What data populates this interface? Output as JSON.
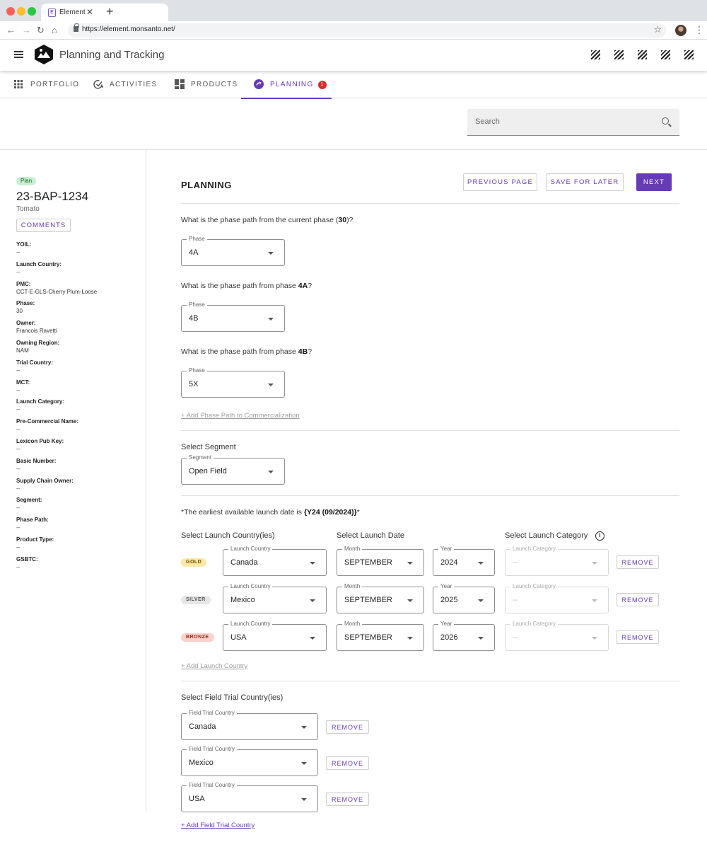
{
  "browser": {
    "tab_title": "Element",
    "tab_close": "✕",
    "new_tab": "+",
    "url": "https://element.monsanto.net/",
    "nav_icons": [
      "back-arrow-icon",
      "forward-arrow-icon",
      "reload-icon",
      "home-icon"
    ]
  },
  "app": {
    "title": "Planning and Tracking"
  },
  "tabs": [
    {
      "label": "PORTFOLIO",
      "icon": "grid-icon"
    },
    {
      "label": "ACTIVITIES",
      "icon": "check-circle-icon"
    },
    {
      "label": "PRODUCTS",
      "icon": "dashboard-icon"
    },
    {
      "label": "PLANNING",
      "icon": "planning-icon",
      "badge": "1",
      "active": true
    }
  ],
  "search": {
    "placeholder": "Search"
  },
  "sidebar": {
    "status": "Plan",
    "id": "23-BAP-1234",
    "crop": "Tomato",
    "comments_label": "COMMENTS",
    "fields": [
      {
        "label": "YOIL:",
        "value": "--"
      },
      {
        "label": "Launch Country:",
        "value": "--"
      },
      {
        "label": "PMC:",
        "value": "CCT-E-GLS-Cherry Plum-Loose"
      },
      {
        "label": "Phase:",
        "value": "30"
      },
      {
        "label": "Owner:",
        "value": "Francois Ravetti"
      },
      {
        "label": "Owning Region:",
        "value": "NAM"
      },
      {
        "label": "Trial Country:",
        "value": "--"
      },
      {
        "label": "MCT:",
        "value": "--"
      },
      {
        "label": "Launch Category:",
        "value": "--"
      },
      {
        "label": "Pre-Commercial Name:",
        "value": "--"
      },
      {
        "label": "Lexicon Pub Key:",
        "value": "--"
      },
      {
        "label": "Basic Number:",
        "value": "--"
      },
      {
        "label": "Supply Chain Owner:",
        "value": "--"
      },
      {
        "label": "Segment:",
        "value": "--"
      },
      {
        "label": "Phase Path:",
        "value": "--"
      },
      {
        "label": "Product Type:",
        "value": "--"
      },
      {
        "label": "GSBTC:",
        "value": "--"
      }
    ]
  },
  "main": {
    "heading": "PLANNING",
    "prev_label": "PREVIOUS PAGE",
    "save_label": "SAVE FOR LATER",
    "next_label": "NEXT",
    "phase_questions": [
      {
        "pre": "What is the phase path from the current phase (",
        "bold": "30",
        "post": ")?",
        "select_label": "Phase",
        "value": "4A"
      },
      {
        "pre": "What is the phase path from phase ",
        "bold": "4A",
        "post": "?",
        "select_label": "Phase",
        "value": "4B"
      },
      {
        "pre": "What is the phase path from phase ",
        "bold": "4B",
        "post": "?",
        "select_label": "Phase",
        "value": "5X"
      }
    ],
    "add_phase_path": "+ Add Phase Path to Commercialization",
    "segment_heading": "Select Segment",
    "segment": {
      "label": "Segment",
      "value": "Open Field"
    },
    "launch_note_pre": "*The earliest available launch date is ",
    "launch_note_bold": "{Y24 (09/2024)}",
    "launch_note_post": "*",
    "launch_country_heading": "Select Launch Country(ies)",
    "launch_date_heading": "Select Launch Date",
    "launch_category_heading": "Select Launch Category",
    "info_icon_glyph": "i",
    "launch_rows": [
      {
        "tier": "GOLD",
        "tier_bg": "#fde8a6",
        "tier_fg": "#6b4e00",
        "country_label": "Launch Country",
        "country": "Canada",
        "month_label": "Month",
        "month": "SEPTEMBER",
        "year_label": "Year",
        "year": "2024",
        "category_label": "Launch Category",
        "category": "--",
        "remove": "REMOVE"
      },
      {
        "tier": "SILVER",
        "tier_bg": "#e6e6e6",
        "tier_fg": "#555555",
        "country_label": "Launch Country",
        "country": "Mexico",
        "month_label": "Month",
        "month": "SEPTEMBER",
        "year_label": "Year",
        "year": "2025",
        "category_label": "Launch Category",
        "category": "--",
        "remove": "REMOVE"
      },
      {
        "tier": "BRONZE",
        "tier_bg": "#f8d2cd",
        "tier_fg": "#a1261a",
        "country_label": "Launch Country",
        "country": "USA",
        "month_label": "Month",
        "month": "SEPTEMBER",
        "year_label": "Year",
        "year": "2026",
        "category_label": "Launch Category",
        "category": "--",
        "remove": "REMOVE"
      }
    ],
    "add_launch_country": "+ Add Launch Country",
    "field_trial_heading": "Select Field Trial Country(ies)",
    "field_trials": [
      {
        "label": "Field Trial Country",
        "value": "Canada",
        "remove": "REMOVE"
      },
      {
        "label": "Field Trial Country",
        "value": "Mexico",
        "remove": "REMOVE"
      },
      {
        "label": "Field Trial Country",
        "value": "USA",
        "remove": "REMOVE"
      }
    ],
    "add_field_trial": "+ Add Field Trial Country"
  },
  "colors": {
    "accent": "#673ab7",
    "badge": "#d32f2f",
    "plan_chip": "#c8f0d2"
  }
}
